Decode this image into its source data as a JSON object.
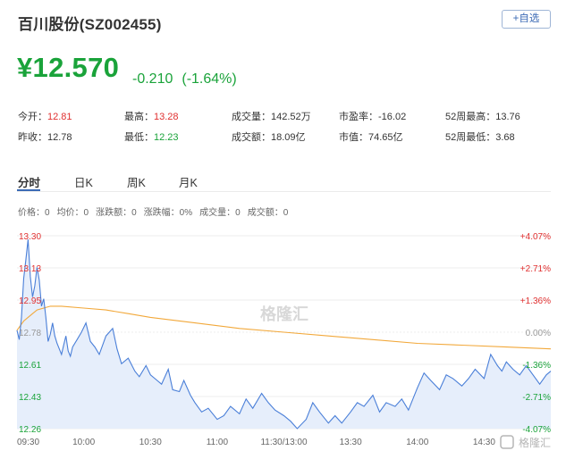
{
  "stock": {
    "title": "百川股份(SZ002455)",
    "add_label": "+自选",
    "price": "¥12.570",
    "change": "-0.210",
    "change_pct": "(-1.64%)"
  },
  "stats": {
    "open_label": "今开：",
    "open": "12.81",
    "high_label": "最高：",
    "high": "13.28",
    "volume_label": "成交量：",
    "volume": "142.52万",
    "pe_label": "市盈率：",
    "pe": "-16.02",
    "w52high_label": "52周最高：",
    "w52high": "13.76",
    "prev_label": "昨收：",
    "prev": "12.78",
    "low_label": "最低：",
    "low": "12.23",
    "amount_label": "成交额：",
    "amount": "18.09亿",
    "mcap_label": "市值：",
    "mcap": "74.65亿",
    "w52low_label": "52周最低：",
    "w52low": "3.68"
  },
  "tabs": [
    "分时",
    "日K",
    "周K",
    "月K"
  ],
  "info": {
    "price": "价格：0",
    "avg": "均价：0",
    "chg": "涨跌额：0",
    "chg_pct": "涨跌幅：0%",
    "vol": "成交量：0",
    "amt": "成交额：0"
  },
  "watermark": "格隆汇",
  "colors": {
    "up": "#e03030",
    "down": "#1aa33a",
    "price_line": "#4a7fd8",
    "avg_line": "#f2a83a",
    "fill": "#e6eefb"
  },
  "chart_data": {
    "type": "line",
    "x_ticks": [
      "09:30",
      "10:00",
      "10:30",
      "11:00",
      "11:30/13:00",
      "13:30",
      "14:00",
      "14:30"
    ],
    "y_ticks_left": [
      "13.30",
      "13.13",
      "12.95",
      "12.78",
      "12.61",
      "12.43",
      "12.26"
    ],
    "y_ticks_right": [
      "+4.07%",
      "+2.71%",
      "+1.36%",
      "0.00%",
      "-1.36%",
      "-2.71%",
      "-4.07%"
    ],
    "ylim": [
      12.26,
      13.3
    ],
    "prev_close": 12.78,
    "x_minutes_range": [
      0,
      240
    ],
    "series": [
      {
        "name": "价格",
        "x": [
          0,
          1,
          2,
          3,
          4,
          5,
          6,
          7,
          8,
          9,
          10,
          11,
          12,
          13,
          14,
          15,
          16,
          17,
          18,
          19,
          20,
          21,
          22,
          23,
          24,
          25,
          27,
          29,
          31,
          33,
          35,
          37,
          40,
          43,
          45,
          47,
          50,
          53,
          55,
          58,
          60,
          63,
          65,
          68,
          70,
          73,
          75,
          78,
          80,
          83,
          86,
          90,
          93,
          96,
          100,
          103,
          106,
          110,
          113,
          116,
          120,
          123,
          126,
          130,
          133,
          136,
          140,
          143,
          146,
          150,
          153,
          156,
          160,
          163,
          166,
          170,
          173,
          176,
          180,
          183,
          186,
          190,
          193,
          196,
          200,
          203,
          206,
          210,
          213,
          216,
          218,
          220,
          223,
          226,
          229,
          232,
          235,
          238,
          240
        ],
        "y": [
          12.79,
          12.74,
          12.86,
          13.07,
          13.17,
          13.28,
          13.08,
          12.97,
          13.03,
          13.13,
          13.06,
          12.92,
          12.96,
          12.86,
          12.73,
          12.77,
          12.83,
          12.76,
          12.72,
          12.69,
          12.66,
          12.71,
          12.76,
          12.68,
          12.65,
          12.7,
          12.74,
          12.78,
          12.83,
          12.73,
          12.7,
          12.66,
          12.76,
          12.8,
          12.69,
          12.61,
          12.64,
          12.57,
          12.54,
          12.6,
          12.55,
          12.52,
          12.5,
          12.58,
          12.47,
          12.46,
          12.52,
          12.44,
          12.4,
          12.35,
          12.37,
          12.31,
          12.33,
          12.38,
          12.34,
          12.42,
          12.37,
          12.45,
          12.4,
          12.36,
          12.33,
          12.3,
          12.26,
          12.31,
          12.4,
          12.35,
          12.29,
          12.33,
          12.29,
          12.35,
          12.4,
          12.38,
          12.44,
          12.35,
          12.4,
          12.38,
          12.42,
          12.36,
          12.48,
          12.56,
          12.52,
          12.47,
          12.55,
          12.53,
          12.49,
          12.53,
          12.58,
          12.53,
          12.66,
          12.6,
          12.57,
          12.62,
          12.58,
          12.55,
          12.6,
          12.55,
          12.5,
          12.55,
          12.57
        ]
      },
      {
        "name": "均价",
        "x": [
          0,
          3,
          6,
          9,
          12,
          15,
          20,
          30,
          40,
          50,
          60,
          80,
          100,
          120,
          140,
          160,
          180,
          200,
          220,
          240
        ],
        "y": [
          12.79,
          12.84,
          12.87,
          12.9,
          12.91,
          12.92,
          12.92,
          12.91,
          12.9,
          12.88,
          12.86,
          12.83,
          12.8,
          12.78,
          12.76,
          12.74,
          12.72,
          12.71,
          12.7,
          12.69
        ]
      }
    ],
    "grid": true
  }
}
